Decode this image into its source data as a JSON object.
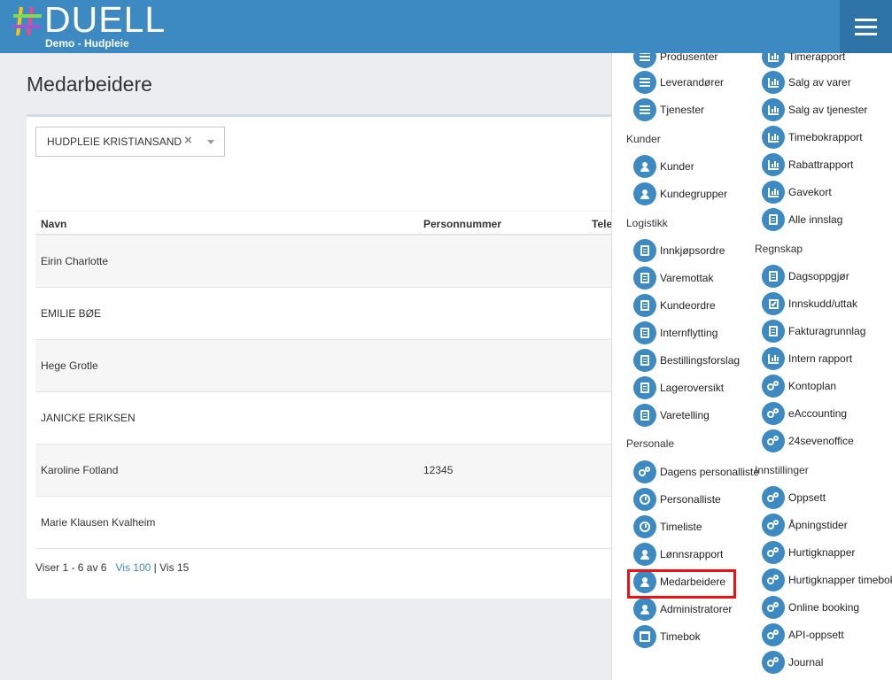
{
  "header": {
    "logo_text": "DUELL",
    "subtitle": "Demo - Hudpleie",
    "accent": "#3d8ac3"
  },
  "page": {
    "title": "Medarbeidere",
    "filter_value": "HUDPLEIE KRISTIANSAND",
    "clear_symbol": "×"
  },
  "table": {
    "columns": [
      "Navn",
      "Personnummer",
      "Tele"
    ],
    "rows": [
      {
        "name": "Eirin Charlotte",
        "personnummer": ""
      },
      {
        "name": "EMILIE BØE",
        "personnummer": ""
      },
      {
        "name": "Hege Grotle",
        "personnummer": ""
      },
      {
        "name": "JANICKE ERIKSEN",
        "personnummer": ""
      },
      {
        "name": "Karoline Fotland",
        "personnummer": "12345"
      },
      {
        "name": "Marie Klausen Kvalheim",
        "personnummer": ""
      }
    ]
  },
  "pager": {
    "summary": "Viser 1 - 6 av 6",
    "show_100": "Vis 100",
    "separator": "|",
    "show_15": "Vis 15"
  },
  "menu": {
    "left": {
      "items_top": [
        {
          "label": "Produsenter",
          "icon": "list-icon"
        },
        {
          "label": "Leverandører",
          "icon": "list-icon"
        },
        {
          "label": "Tjenester",
          "icon": "list-icon"
        }
      ],
      "kunder_heading": "Kunder",
      "kunder": [
        {
          "label": "Kunder",
          "icon": "users-icon"
        },
        {
          "label": "Kundegrupper",
          "icon": "users-icon"
        }
      ],
      "logistikk_heading": "Logistikk",
      "logistikk": [
        {
          "label": "Innkjøpsordre",
          "icon": "document-icon"
        },
        {
          "label": "Varemottak",
          "icon": "document-icon"
        },
        {
          "label": "Kundeordre",
          "icon": "document-icon"
        },
        {
          "label": "Internflytting",
          "icon": "document-icon"
        },
        {
          "label": "Bestillingsforslag",
          "icon": "document-icon"
        },
        {
          "label": "Lageroversikt",
          "icon": "document-icon"
        },
        {
          "label": "Varetelling",
          "icon": "document-icon"
        }
      ],
      "personale_heading": "Personale",
      "personale": [
        {
          "label": "Dagens personalliste",
          "icon": "gears-icon"
        },
        {
          "label": "Personalliste",
          "icon": "clock-icon"
        },
        {
          "label": "Timeliste",
          "icon": "clock-icon"
        },
        {
          "label": "Lønnsrapport",
          "icon": "users-icon"
        },
        {
          "label": "Medarbeidere",
          "icon": "users-icon"
        },
        {
          "label": "Administratorer",
          "icon": "users-icon"
        },
        {
          "label": "Timebok",
          "icon": "calendar-check-icon"
        }
      ]
    },
    "right": {
      "rapporter": [
        {
          "label": "Timerapport",
          "icon": "chart-icon"
        },
        {
          "label": "Salg av varer",
          "icon": "chart-icon"
        },
        {
          "label": "Salg av tjenester",
          "icon": "chart-icon"
        },
        {
          "label": "Timebokrapport",
          "icon": "chart-icon"
        },
        {
          "label": "Rabattrapport",
          "icon": "chart-icon"
        },
        {
          "label": "Gavekort",
          "icon": "chart-icon"
        },
        {
          "label": "Alle innslag",
          "icon": "document-icon"
        }
      ],
      "regnskap_heading": "Regnskap",
      "regnskap": [
        {
          "label": "Dagsoppgjør",
          "icon": "document-icon"
        },
        {
          "label": "Innskudd/uttak",
          "icon": "checkbox-icon"
        },
        {
          "label": "Fakturagrunnlag",
          "icon": "document-icon"
        },
        {
          "label": "Intern rapport",
          "icon": "chart-icon"
        },
        {
          "label": "Kontoplan",
          "icon": "gears-icon"
        },
        {
          "label": "eAccounting",
          "icon": "gears-icon"
        },
        {
          "label": "24sevenoffice",
          "icon": "gears-icon"
        }
      ],
      "innstillinger_heading": "Innstillinger",
      "innstillinger": [
        {
          "label": "Oppsett",
          "icon": "gears-icon"
        },
        {
          "label": "Åpningstider",
          "icon": "gears-icon"
        },
        {
          "label": "Hurtigknapper",
          "icon": "gears-icon"
        },
        {
          "label": "Hurtigknapper timebok",
          "icon": "gears-icon"
        },
        {
          "label": "Online booking",
          "icon": "gears-icon"
        },
        {
          "label": "API-oppsett",
          "icon": "gears-icon"
        },
        {
          "label": "Journal",
          "icon": "gears-icon"
        }
      ]
    },
    "highlight_color": "#ee1111"
  }
}
